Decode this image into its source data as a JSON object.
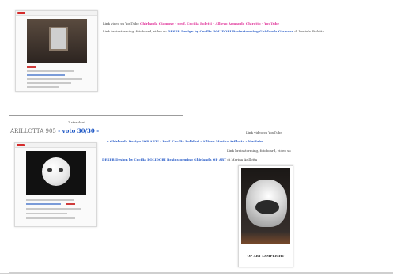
{
  "post1": {
    "line1_prefix": "Link video su YouTube ",
    "line1_link": "Ghirlanda Giamose - prof. Cecilia Poletti - Allievo Armando Ghirotto - YouTube",
    "line2_prefix": "Link brainstorming, fotoboard, video su ",
    "line2_link": "DESPR Design by Cecilia POLIDORI Brainstorming Ghirlanda Giamose",
    "line2_suffix": " di Daniela Fioletta"
  },
  "post2": {
    "caption_top": "7 standard",
    "heading_name": "ARILLOTTA 905",
    "heading_score": " - voto 30/30 - ",
    "line1": "Link video su YouTube",
    "line2_link": "e Ghirlanda Design \"OP ART\" - Prof. Cecilia Polidori - Allievo Marina Arillotta - YouTube",
    "line3": "Link brainstorming, fotoboard, video su",
    "line4_link": "DESPR Design by Cecilia POLIDORI Brainstorming Ghirlanda OP ART",
    "line4_suffix": " di Marina Arillotta",
    "poster_caption": "OP ART LAMPLIGHT"
  },
  "colors": {
    "link_pink": "#e0359a",
    "link_blue": "#2d5fc8",
    "heading_gray": "#6b6b6b"
  }
}
